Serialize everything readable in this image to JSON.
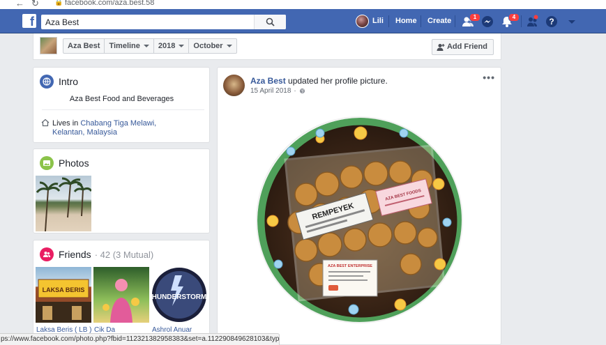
{
  "browser": {
    "url": "facebook.com/aza.best.58",
    "status_url": "ps://www.facebook.com/photo.php?fbid=112321382958383&set=a.112290849628103&type=3"
  },
  "topbar": {
    "search_value": "Aza Best",
    "user_name": "Lili",
    "home_label": "Home",
    "create_label": "Create",
    "friend_requests_badge": "1",
    "notifications_badge": "4",
    "brand_color": "#4267b2"
  },
  "timeline_nav": {
    "profile_name": "Aza Best",
    "section": "Timeline",
    "year": "2018",
    "month": "October",
    "add_friend_label": "Add Friend"
  },
  "intro": {
    "title": "Intro",
    "bio": "Aza Best Food and Beverages",
    "lives_prefix": "Lives in ",
    "lives_place": "Chabang Tiga Melawi, Kelantan, Malaysia"
  },
  "photos": {
    "title": "Photos"
  },
  "friends": {
    "title": "Friends",
    "count": "· 42 (3 Mutual)",
    "items": [
      {
        "name": "Laksa Beris ( LB )",
        "sign_text": "LAKSA BERIS"
      },
      {
        "name": "Cik Da"
      },
      {
        "name": "Ashrol Anuar",
        "logo_text": "HUNDERSTORM"
      }
    ]
  },
  "post": {
    "author": "Aza Best",
    "action": " updated her profile picture.",
    "date": "15 April 2018",
    "label_rempeyek": "REMPEYEK",
    "label_enterprise": "AZA BEST ENTERPRISE",
    "label_pink": "AZA BEST FOODS"
  }
}
